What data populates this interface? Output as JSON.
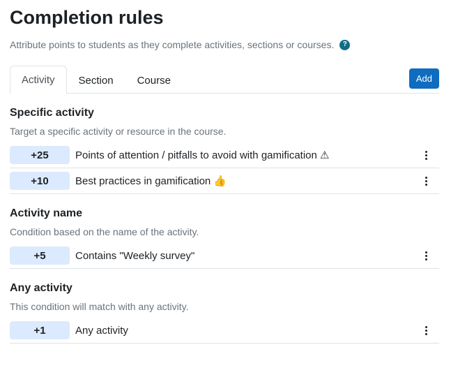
{
  "header": {
    "title": "Completion rules",
    "subtitle": "Attribute points to students as they complete activities, sections or courses.",
    "help_icon": "?"
  },
  "tabs": [
    {
      "label": "Activity",
      "active": true
    },
    {
      "label": "Section",
      "active": false
    },
    {
      "label": "Course",
      "active": false
    }
  ],
  "add_button": "Add",
  "colors": {
    "accent": "#0f6cbf",
    "badge_bg": "#dbeafe",
    "help_icon_bg": "#0f6e84"
  },
  "sections": [
    {
      "title": "Specific activity",
      "description": "Target a specific activity or resource in the course.",
      "rules": [
        {
          "points": "+25",
          "label": "Points of attention / pitfalls to avoid with gamification ⚠"
        },
        {
          "points": "+10",
          "label": "Best practices in gamification 👍"
        }
      ]
    },
    {
      "title": "Activity name",
      "description": "Condition based on the name of the activity.",
      "rules": [
        {
          "points": "+5",
          "label": "Contains \"Weekly survey\""
        }
      ]
    },
    {
      "title": "Any activity",
      "description": "This condition will match with any activity.",
      "rules": [
        {
          "points": "+1",
          "label": "Any activity"
        }
      ]
    }
  ]
}
